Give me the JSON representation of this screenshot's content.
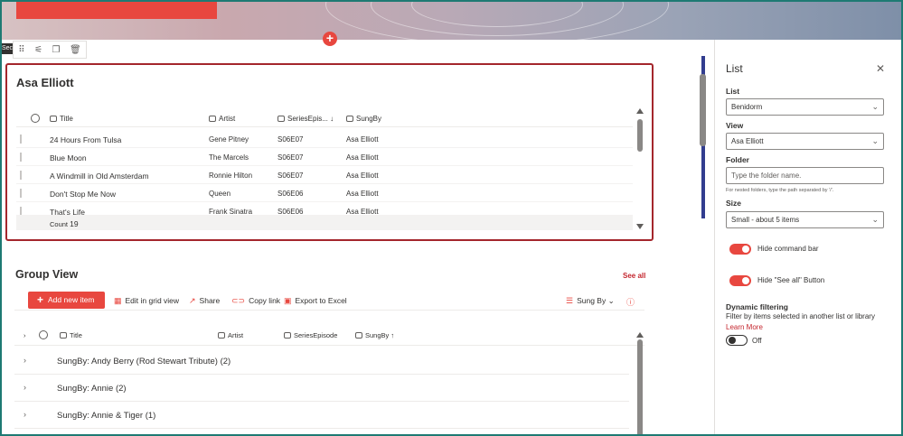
{
  "colors": {
    "accent": "#e8473f",
    "link": "#c4262e",
    "border_selected": "#a4262c"
  },
  "page": {
    "section_tag": "Sec"
  },
  "web_part_list": {
    "title": "Asa Elliott",
    "columns": [
      "Title",
      "Artist",
      "SeriesEpis...",
      "SungBy"
    ],
    "rows": [
      {
        "title": "24 Hours From Tulsa",
        "artist": "Gene Pitney",
        "episode": "S06E07",
        "sungby": "Asa Elliott"
      },
      {
        "title": "Blue Moon",
        "artist": "The Marcels",
        "episode": "S06E07",
        "sungby": "Asa Elliott"
      },
      {
        "title": "A Windmill in Old Amsterdam",
        "artist": "Ronnie Hilton",
        "episode": "S06E07",
        "sungby": "Asa Elliott"
      },
      {
        "title": "Don't Stop Me Now",
        "artist": "Queen",
        "episode": "S06E06",
        "sungby": "Asa Elliott"
      },
      {
        "title": "That's Life",
        "artist": "Frank Sinatra",
        "episode": "S06E06",
        "sungby": "Asa Elliott"
      }
    ],
    "count_label": "Count",
    "count_value": "19"
  },
  "group_view": {
    "title": "Group View",
    "see_all": "See all",
    "commands": {
      "new_item": "Add new item",
      "edit_grid": "Edit in grid view",
      "share": "Share",
      "copy_link": "Copy link",
      "export": "Export to Excel",
      "sung_by": "Sung By"
    },
    "columns": [
      "Title",
      "Artist",
      "SeriesEpisode",
      "SungBy"
    ],
    "groups": [
      "SungBy: Andy Berry (Rod Stewart Tribute) (2)",
      "SungBy: Annie (2)",
      "SungBy: Annie & Tiger (1)"
    ]
  },
  "pane": {
    "title": "List",
    "list_label": "List",
    "list_value": "Benidorm",
    "view_label": "View",
    "view_value": "Asa Elliott",
    "folder_label": "Folder",
    "folder_placeholder": "Type the folder name.",
    "folder_hint": "For nested folders, type the path separated by '/'.",
    "size_label": "Size",
    "size_value": "Small - about 5 items",
    "hide_command_bar": "Hide command bar",
    "hide_see_all": "Hide \"See all\" Button",
    "dynamic_title": "Dynamic filtering",
    "dynamic_desc": "Filter by items selected in another list or library",
    "learn_more": "Learn More",
    "off_label": "Off"
  }
}
